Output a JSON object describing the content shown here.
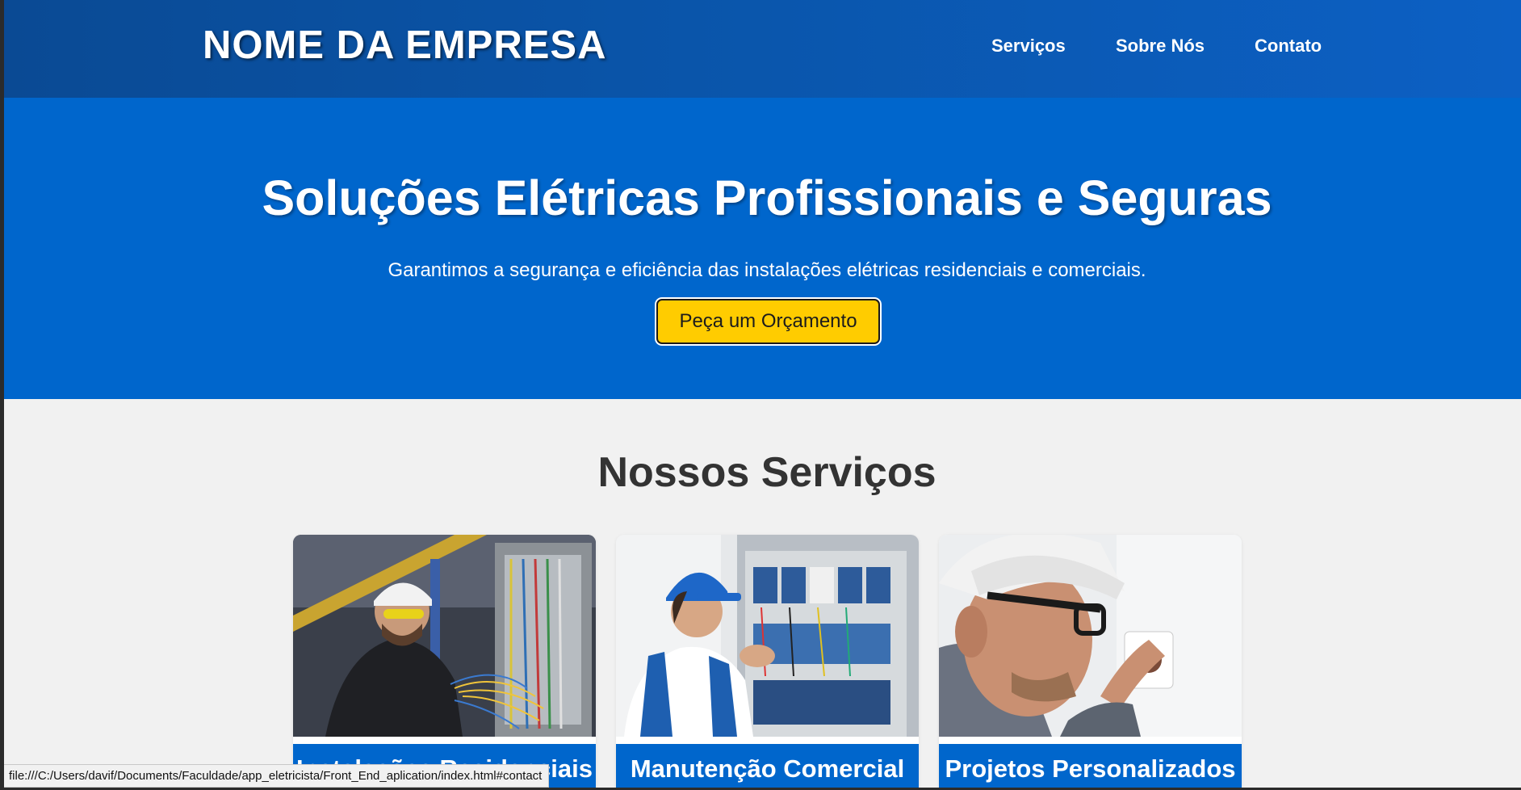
{
  "header": {
    "brand": "NOME DA EMPRESA",
    "nav": [
      {
        "label": "Serviços"
      },
      {
        "label": "Sobre Nós"
      },
      {
        "label": "Contato"
      }
    ]
  },
  "hero": {
    "title": "Soluções Elétricas Profissionais e Seguras",
    "subtitle": "Garantimos a segurança e eficiência das instalações elétricas residenciais e comerciais.",
    "cta_label": "Peça um Orçamento"
  },
  "services": {
    "title": "Nossos Serviços",
    "cards": [
      {
        "label": "Instalações Residenciais",
        "image_icon": "electrician-wiring-panel-photo"
      },
      {
        "label": "Manutenção Comercial",
        "image_icon": "electrician-electrical-cabinet-photo"
      },
      {
        "label": "Projetos Personalizados",
        "image_icon": "electrician-socket-install-photo"
      }
    ]
  },
  "status_bar": {
    "url": "file:///C:/Users/davif/Documents/Faculdade/app_eletricista/Front_End_aplication/index.html#contact"
  },
  "colors": {
    "header": "#0a55aa",
    "hero": "#0066cc",
    "cta": "#ffcc00",
    "background": "#f1f1f1",
    "card_label": "#0066cc"
  }
}
